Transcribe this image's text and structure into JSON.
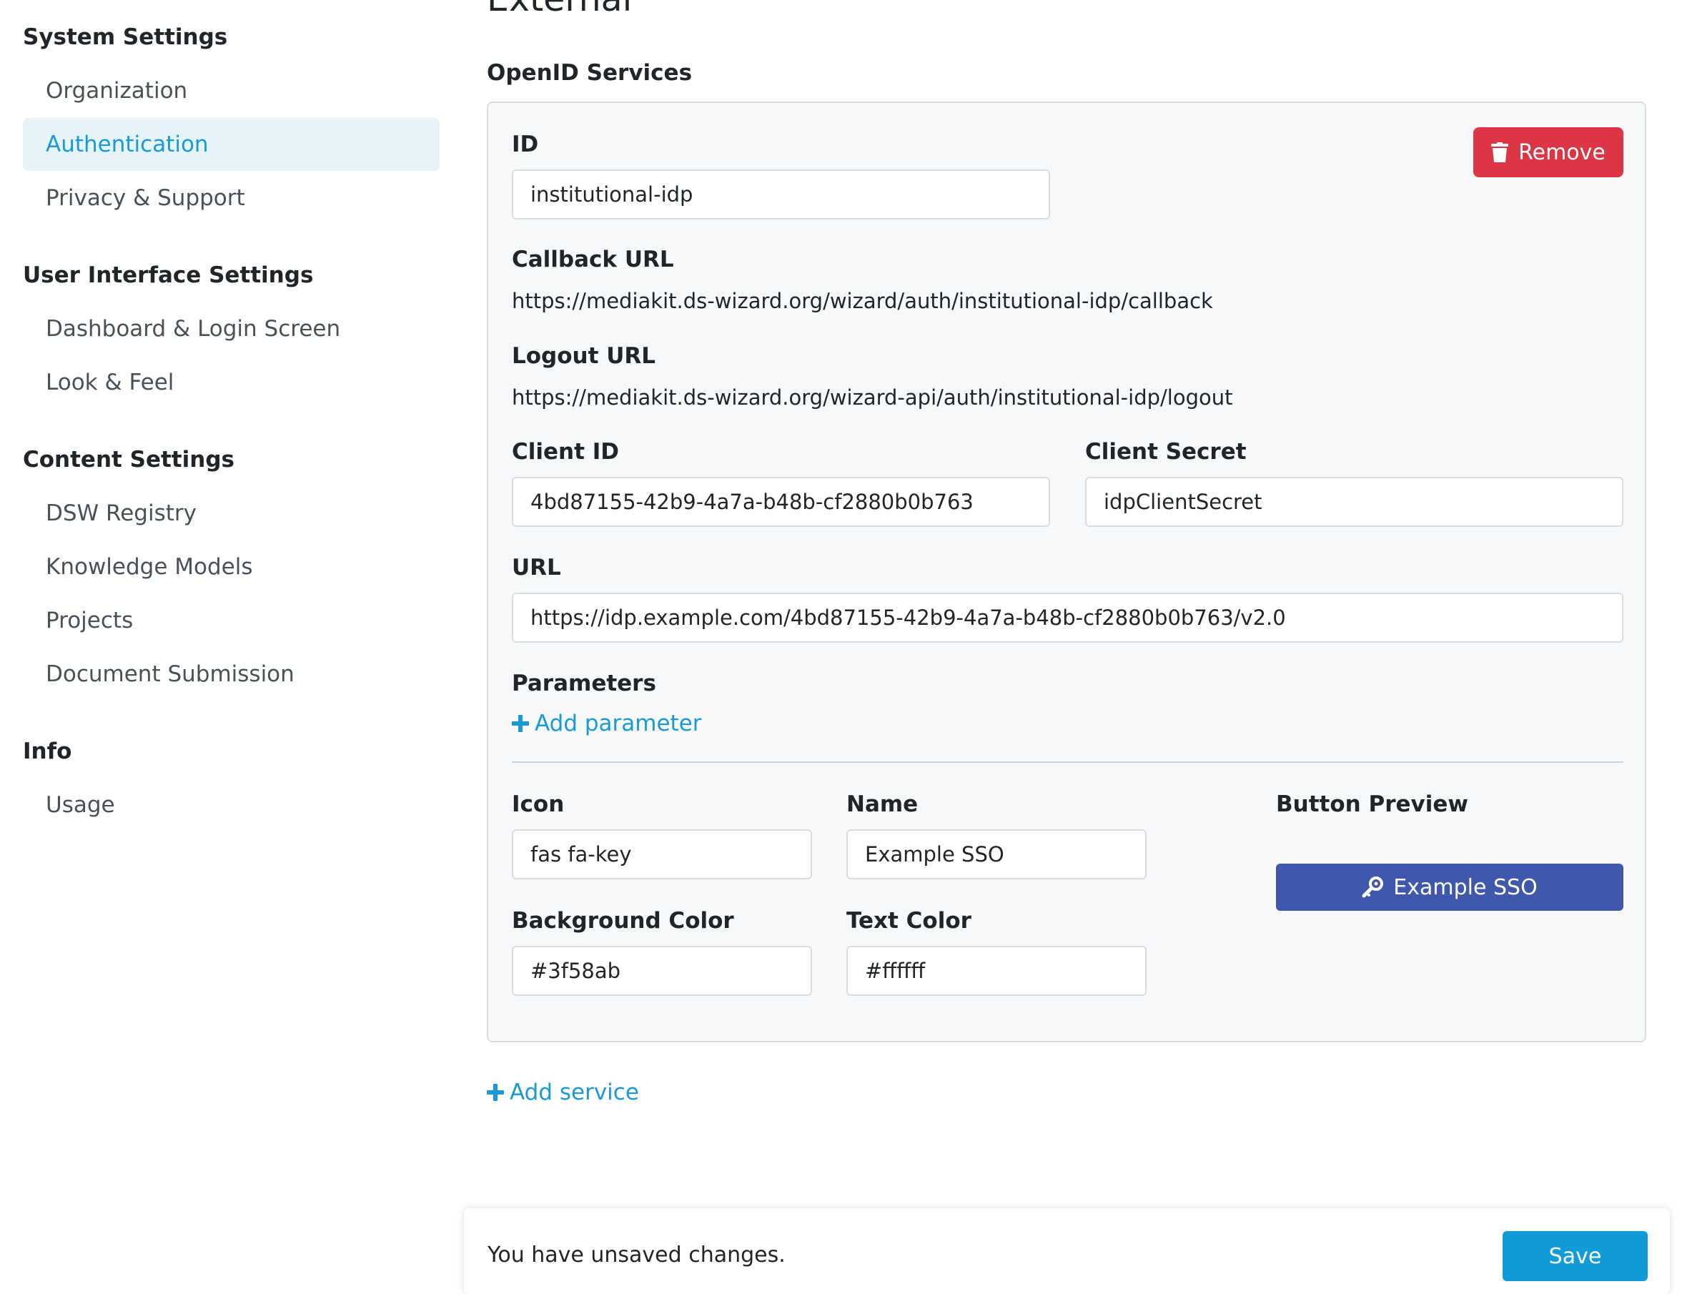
{
  "sidebar": {
    "groups": [
      {
        "title": "System Settings",
        "items": [
          "Organization",
          "Authentication",
          "Privacy & Support"
        ]
      },
      {
        "title": "User Interface Settings",
        "items": [
          "Dashboard & Login Screen",
          "Look & Feel"
        ]
      },
      {
        "title": "Content Settings",
        "items": [
          "DSW Registry",
          "Knowledge Models",
          "Projects",
          "Document Submission"
        ]
      },
      {
        "title": "Info",
        "items": [
          "Usage"
        ]
      }
    ],
    "active_item": "Authentication"
  },
  "main": {
    "title": "External",
    "section_title": "OpenID Services",
    "service": {
      "id_label": "ID",
      "id_value": "institutional-idp",
      "remove_label": "Remove",
      "callback_label": "Callback URL",
      "callback_url": "https://mediakit.ds-wizard.org/wizard/auth/institutional-idp/callback",
      "logout_label": "Logout URL",
      "logout_url": "https://mediakit.ds-wizard.org/wizard-api/auth/institutional-idp/logout",
      "client_id_label": "Client ID",
      "client_id_value": "4bd87155-42b9-4a7a-b48b-cf2880b0b763",
      "client_secret_label": "Client Secret",
      "client_secret_value": "idpClientSecret",
      "url_label": "URL",
      "url_value": "https://idp.example.com/4bd87155-42b9-4a7a-b48b-cf2880b0b763/v2.0",
      "parameters_label": "Parameters",
      "add_parameter_label": "Add parameter",
      "icon_label": "Icon",
      "icon_value": "fas fa-key",
      "name_label": "Name",
      "name_value": "Example SSO",
      "button_preview_label": "Button Preview",
      "preview_button_text": "Example SSO",
      "preview_icon": "key-icon",
      "bg_color_label": "Background Color",
      "bg_color_value": "#3f58ab",
      "text_color_label": "Text Color",
      "text_color_value": "#ffffff"
    },
    "add_service_label": "Add service"
  },
  "footer": {
    "message": "You have unsaved changes.",
    "save_label": "Save"
  },
  "colors": {
    "accent": "#1a9ad3",
    "active_bg": "#e6f4fa",
    "danger": "#dc3545",
    "save_button": "#0f9cd8",
    "preview_bg": "#3f58ab",
    "preview_text": "#ffffff"
  }
}
